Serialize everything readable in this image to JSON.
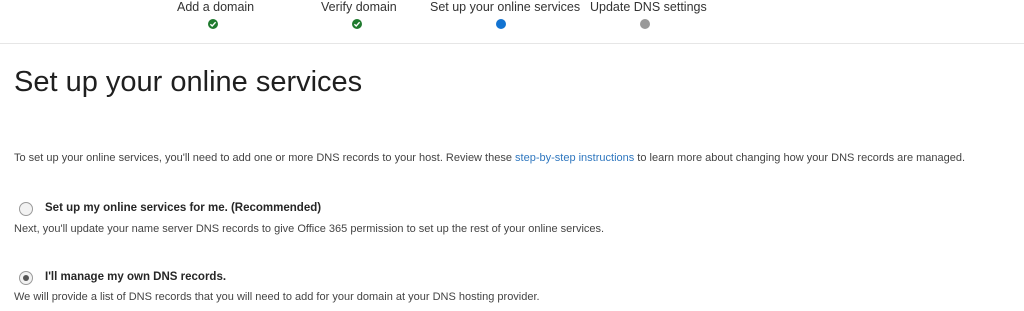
{
  "steps": [
    {
      "label": "Add a domain",
      "status": "done"
    },
    {
      "label": "Verify domain",
      "status": "done"
    },
    {
      "label": "Set up your online services",
      "status": "current"
    },
    {
      "label": "Update DNS settings",
      "status": "pending"
    }
  ],
  "page": {
    "title": "Set up your online services",
    "intro_before": "To set up your online services, you'll need to add one or more DNS records to your host. Review these ",
    "intro_link": "step-by-step instructions",
    "intro_after": " to learn more about changing how your DNS records are managed."
  },
  "options": [
    {
      "label": "Set up my online services for me. (Recommended)",
      "description": "Next, you'll update your name server DNS records to give Office 365 permission to set up the rest of your online services.",
      "checked": false
    },
    {
      "label": "I'll manage my own DNS records.",
      "description": "We will provide a list of DNS records that you will need to add for your domain at your DNS hosting provider.",
      "checked": true
    }
  ],
  "colors": {
    "done": "#1f7a2e",
    "current": "#1273d1",
    "pending": "#999999",
    "link": "#2f77bf"
  }
}
